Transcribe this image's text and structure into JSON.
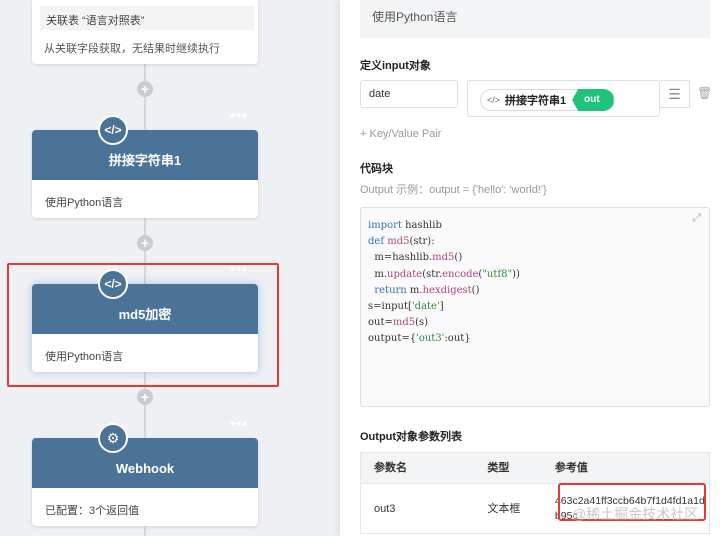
{
  "canvas": {
    "top_card": {
      "tag": "关联表 “语言对照表”",
      "desc": "从关联字段获取，无结果时继续执行"
    },
    "nodes": [
      {
        "title": "拼接字符串1",
        "desc": "使用Python语言",
        "icon": "code-icon",
        "icon_glyph": "</>"
      },
      {
        "title": "md5加密",
        "desc": "使用Python语言",
        "icon": "code-icon",
        "icon_glyph": "</>"
      },
      {
        "title": "Webhook",
        "desc": "已配置：3个返回值",
        "icon": "webhook-icon",
        "icon_glyph": "⚙"
      }
    ],
    "menu_glyph": "•••",
    "plus_glyph": "+"
  },
  "panel": {
    "description": "使用Python语言",
    "input_section_title": "定义input对象",
    "input_key": "date",
    "input_ref": {
      "name": "拼接字符串1",
      "field": "out",
      "icon_glyph": "</>"
    },
    "add_pair_label": "+ Key/Value Pair",
    "code_section_title": "代码块",
    "output_hint": "Output 示例：output = {'hello': 'world!'}",
    "code_lines": [
      "import hashlib",
      "def md5(str):",
      "  m=hashlib.md5()",
      "  m.update(str.encode(\"utf8\"))",
      "  return m.hexdigest()",
      "s=input['date']",
      "out=md5(s)",
      "output={'out3':out}"
    ],
    "output_section_title": "Output对象参数列表",
    "table": {
      "headers": [
        "参数名",
        "类型",
        "参考值"
      ],
      "rows": [
        {
          "name": "out3",
          "type": "文本框",
          "ref": "463c2a41ff3ccb64b7f1d4fd1a1db95c"
        }
      ]
    }
  },
  "watermark": "@稀土掘金技术社区",
  "colors": {
    "node_header": "#4b7297",
    "out_tag": "#1ec37a",
    "highlight": "#e53935"
  }
}
